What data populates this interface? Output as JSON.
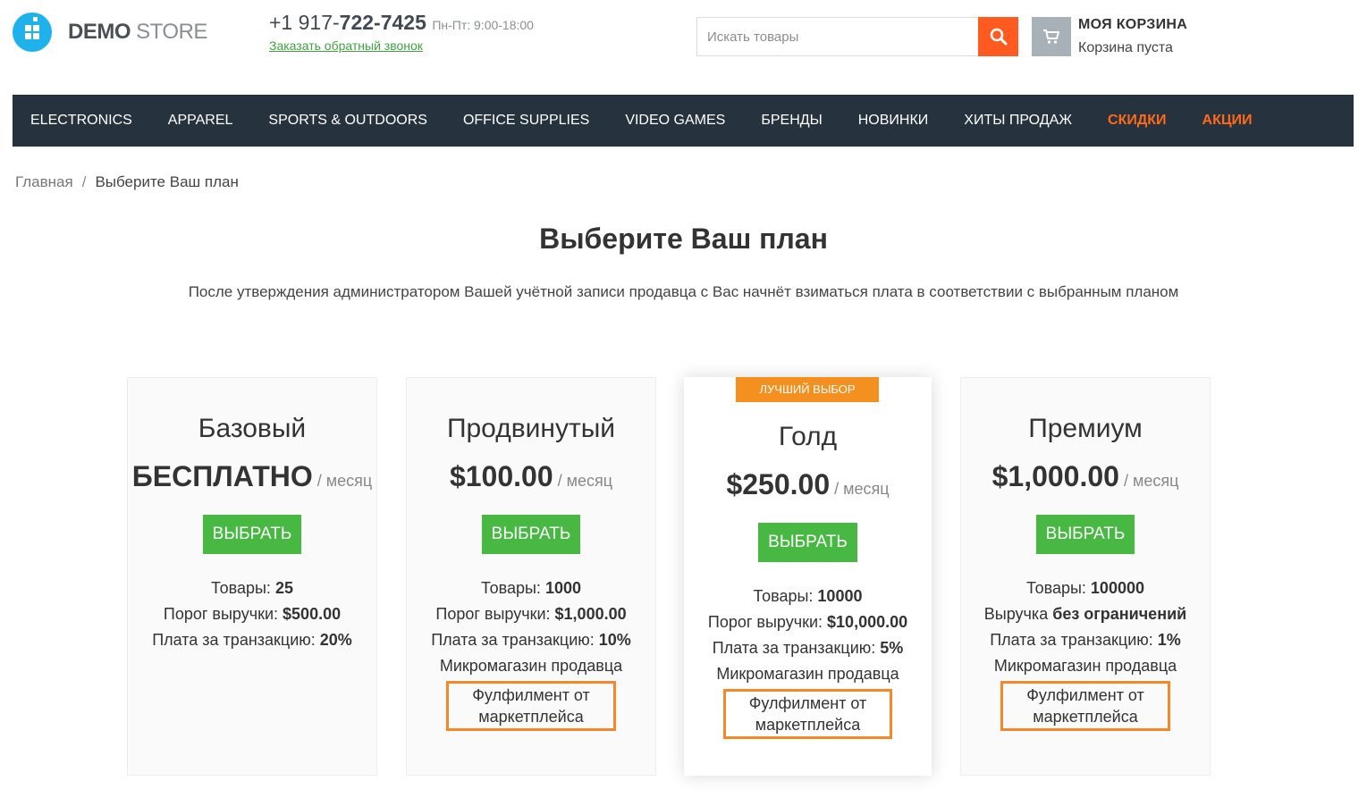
{
  "header": {
    "logo": {
      "brand_bold": "DEMO",
      "brand_light": " STORE"
    },
    "phone": {
      "prefix": "+1 917-",
      "main": "722-7425",
      "hours": "Пн-Пт: 9:00-18:00"
    },
    "callback_link": "Заказать обратный звонок",
    "search": {
      "placeholder": "Искать товары"
    },
    "cart": {
      "title": "МОЯ КОРЗИНА",
      "status": "Корзина пуста"
    }
  },
  "nav": {
    "items": [
      {
        "label": "ELECTRONICS"
      },
      {
        "label": "APPAREL"
      },
      {
        "label": "SPORTS & OUTDOORS"
      },
      {
        "label": "OFFICE SUPPLIES"
      },
      {
        "label": "VIDEO GAMES"
      },
      {
        "label": "БРЕНДЫ"
      },
      {
        "label": "НОВИНКИ"
      },
      {
        "label": "ХИТЫ ПРОДАЖ"
      },
      {
        "label": "СКИДКИ"
      },
      {
        "label": "АКЦИИ"
      }
    ],
    "accent_color": "#ff6a1a",
    "background_color": "#26323e"
  },
  "breadcrumb": {
    "home": "Главная",
    "separator": "/",
    "current": "Выберите Ваш план"
  },
  "page": {
    "title": "Выберите Ваш план",
    "subtitle": "После утверждения администратором Вашей учётной записи продавца с Вас начнёт взиматься плата в соответствии с выбранным планом"
  },
  "plans": [
    {
      "name": "Базовый",
      "price": "БЕСПЛАТНО",
      "period": " / месяц",
      "button": "ВЫБРАТЬ",
      "products_label": "Товары: ",
      "products_value": "25",
      "revenue_label": "Порог выручки: ",
      "revenue_value": "$500.00",
      "fee_label": "Плата за транзакцию: ",
      "fee_value": "20%"
    },
    {
      "name": "Продвинутый",
      "price": "$100.00",
      "period": " / месяц",
      "button": "ВЫБРАТЬ",
      "products_label": "Товары: ",
      "products_value": "1000",
      "revenue_label": "Порог выручки: ",
      "revenue_value": "$1,000.00",
      "fee_label": "Плата за транзакцию: ",
      "fee_value": "10%",
      "storefront": "Микромагазин продавца",
      "fulfilment_line1": "Фулфилмент от",
      "fulfilment_line2": "маркетплейса"
    },
    {
      "badge": "ЛУЧШИЙ ВЫБОР",
      "name": "Голд",
      "price": "$250.00",
      "period": " / месяц",
      "button": "ВЫБРАТЬ",
      "products_label": "Товары: ",
      "products_value": "10000",
      "revenue_label": "Порог выручки: ",
      "revenue_value": "$10,000.00",
      "fee_label": "Плата за транзакцию: ",
      "fee_value": "5%",
      "storefront": "Микромагазин продавца",
      "fulfilment_line1": "Фулфилмент от",
      "fulfilment_line2": "маркетплейса"
    },
    {
      "name": "Премиум",
      "price": "$1,000.00",
      "period": " / месяц",
      "button": "ВЫБРАТЬ",
      "products_label": "Товары: ",
      "products_value": "100000",
      "revenue_label": "Выручка ",
      "revenue_value": "без ограничений",
      "fee_label": "Плата за транзакцию: ",
      "fee_value": "1%",
      "storefront": "Микромагазин продавца",
      "fulfilment_line1": "Фулфилмент от",
      "fulfilment_line2": "маркетплейса"
    }
  ],
  "colors": {
    "button_green": "#47b842",
    "highlight_orange": "#f4892a",
    "search_orange": "#ff5a1f",
    "logo_blue": "#1fb1ea"
  }
}
